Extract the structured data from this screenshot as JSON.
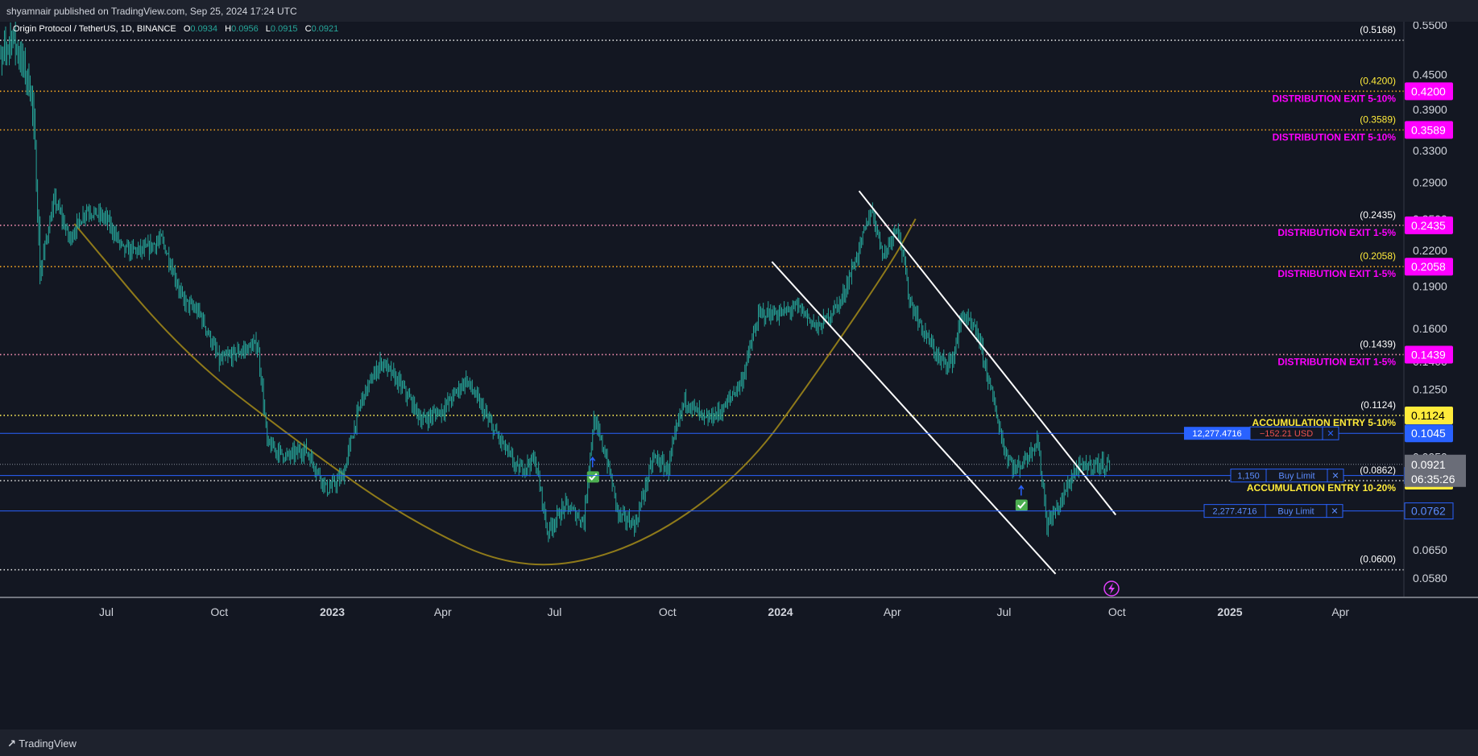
{
  "header": {
    "published": "shyamnair published on TradingView.com, Sep 25, 2024 17:24 UTC"
  },
  "footer": {
    "brand": "TradingView"
  },
  "legend": {
    "symbol": "Origin Protocol / TetherUS, 1D, BINANCE",
    "o_label": "O",
    "o_value": "0.0934",
    "h_label": "H",
    "h_value": "0.0956",
    "l_label": "L",
    "l_value": "0.0915",
    "c_label": "C",
    "c_value": "0.0921"
  },
  "colors": {
    "background": "#131722",
    "candle": "#26a69a",
    "orange_level": "#f5a623",
    "magenta_label": "#ff00ff",
    "yellow_label": "#ffeb3b",
    "blue_line": "#2962ff",
    "curve": "#8f7a1a"
  },
  "chart_data": {
    "type": "candlestick",
    "title": "Origin Protocol / TetherUS, 1D, BINANCE",
    "y_axis": {
      "ticks": [
        "0.5500",
        "0.4500",
        "0.3900",
        "0.3300",
        "0.2900",
        "0.2500",
        "0.2200",
        "0.1900",
        "0.1600",
        "0.1400",
        "0.1250",
        "0.0950",
        "0.0650",
        "0.0580"
      ],
      "tick_values": [
        0.55,
        0.45,
        0.39,
        0.33,
        0.29,
        0.25,
        0.22,
        0.19,
        0.16,
        0.14,
        0.125,
        0.095,
        0.065,
        0.058
      ]
    },
    "x_axis": {
      "ticks": [
        {
          "label": "Jul",
          "date": "2022-07-01",
          "bold": false
        },
        {
          "label": "Oct",
          "date": "2022-10-01",
          "bold": false
        },
        {
          "label": "2023",
          "date": "2023-01-01",
          "bold": true
        },
        {
          "label": "Apr",
          "date": "2023-04-01",
          "bold": false
        },
        {
          "label": "Jul",
          "date": "2023-07-01",
          "bold": false
        },
        {
          "label": "Oct",
          "date": "2023-10-01",
          "bold": false
        },
        {
          "label": "2024",
          "date": "2024-01-01",
          "bold": true
        },
        {
          "label": "Apr",
          "date": "2024-04-01",
          "bold": false
        },
        {
          "label": "Jul",
          "date": "2024-07-01",
          "bold": false
        },
        {
          "label": "Oct",
          "date": "2024-10-01",
          "bold": false
        },
        {
          "label": "2025",
          "date": "2025-01-01",
          "bold": true
        },
        {
          "label": "Apr",
          "date": "2025-04-01",
          "bold": false
        }
      ]
    },
    "price_path": [
      {
        "date": "2022-04-01",
        "price": 0.44
      },
      {
        "date": "2022-04-15",
        "price": 0.53
      },
      {
        "date": "2022-05-01",
        "price": 0.42
      },
      {
        "date": "2022-05-08",
        "price": 0.2
      },
      {
        "date": "2022-05-20",
        "price": 0.27
      },
      {
        "date": "2022-06-01",
        "price": 0.23
      },
      {
        "date": "2022-06-15",
        "price": 0.26
      },
      {
        "date": "2022-07-01",
        "price": 0.25
      },
      {
        "date": "2022-07-15",
        "price": 0.22
      },
      {
        "date": "2022-08-01",
        "price": 0.22
      },
      {
        "date": "2022-08-15",
        "price": 0.23
      },
      {
        "date": "2022-09-01",
        "price": 0.18
      },
      {
        "date": "2022-09-15",
        "price": 0.17
      },
      {
        "date": "2022-10-01",
        "price": 0.14
      },
      {
        "date": "2022-10-15",
        "price": 0.145
      },
      {
        "date": "2022-11-01",
        "price": 0.15
      },
      {
        "date": "2022-11-09",
        "price": 0.1
      },
      {
        "date": "2022-11-25",
        "price": 0.095
      },
      {
        "date": "2022-12-10",
        "price": 0.098
      },
      {
        "date": "2022-12-28",
        "price": 0.083
      },
      {
        "date": "2023-01-10",
        "price": 0.088
      },
      {
        "date": "2023-01-25",
        "price": 0.12
      },
      {
        "date": "2023-02-10",
        "price": 0.14
      },
      {
        "date": "2023-02-28",
        "price": 0.125
      },
      {
        "date": "2023-03-15",
        "price": 0.11
      },
      {
        "date": "2023-04-01",
        "price": 0.115
      },
      {
        "date": "2023-04-20",
        "price": 0.13
      },
      {
        "date": "2023-05-10",
        "price": 0.108
      },
      {
        "date": "2023-06-01",
        "price": 0.09
      },
      {
        "date": "2023-06-15",
        "price": 0.094
      },
      {
        "date": "2023-06-25",
        "price": 0.07
      },
      {
        "date": "2023-07-10",
        "price": 0.078
      },
      {
        "date": "2023-07-25",
        "price": 0.073
      },
      {
        "date": "2023-08-02",
        "price": 0.11
      },
      {
        "date": "2023-08-12",
        "price": 0.095
      },
      {
        "date": "2023-08-22",
        "price": 0.075
      },
      {
        "date": "2023-09-05",
        "price": 0.072
      },
      {
        "date": "2023-09-20",
        "price": 0.095
      },
      {
        "date": "2023-10-01",
        "price": 0.09
      },
      {
        "date": "2023-10-15",
        "price": 0.12
      },
      {
        "date": "2023-11-01",
        "price": 0.11
      },
      {
        "date": "2023-11-15",
        "price": 0.115
      },
      {
        "date": "2023-12-01",
        "price": 0.13
      },
      {
        "date": "2023-12-15",
        "price": 0.17
      },
      {
        "date": "2024-01-01",
        "price": 0.17
      },
      {
        "date": "2024-01-15",
        "price": 0.175
      },
      {
        "date": "2024-02-01",
        "price": 0.16
      },
      {
        "date": "2024-02-20",
        "price": 0.18
      },
      {
        "date": "2024-03-05",
        "price": 0.22
      },
      {
        "date": "2024-03-15",
        "price": 0.26
      },
      {
        "date": "2024-03-25",
        "price": 0.215
      },
      {
        "date": "2024-04-05",
        "price": 0.245
      },
      {
        "date": "2024-04-15",
        "price": 0.18
      },
      {
        "date": "2024-04-25",
        "price": 0.16
      },
      {
        "date": "2024-05-10",
        "price": 0.14
      },
      {
        "date": "2024-05-20",
        "price": 0.14
      },
      {
        "date": "2024-05-28",
        "price": 0.17
      },
      {
        "date": "2024-06-10",
        "price": 0.155
      },
      {
        "date": "2024-06-20",
        "price": 0.125
      },
      {
        "date": "2024-07-01",
        "price": 0.098
      },
      {
        "date": "2024-07-10",
        "price": 0.09
      },
      {
        "date": "2024-07-20",
        "price": 0.095
      },
      {
        "date": "2024-07-28",
        "price": 0.102
      },
      {
        "date": "2024-08-05",
        "price": 0.072
      },
      {
        "date": "2024-08-15",
        "price": 0.078
      },
      {
        "date": "2024-08-28",
        "price": 0.09
      },
      {
        "date": "2024-09-10",
        "price": 0.092
      },
      {
        "date": "2024-09-25",
        "price": 0.0921
      }
    ],
    "horizontal_levels": [
      {
        "price": 0.5168,
        "style": "white-dotted",
        "right_label": "(0.5168)",
        "right_label_color": "white"
      },
      {
        "price": 0.42,
        "style": "orange-dotted",
        "right_label": "(0.4200)",
        "right_label_color": "yellow",
        "axis_tag": "0.4200",
        "axis_tag_color": "magenta",
        "note": "DISTRIBUTION EXIT 5-10%",
        "note_color": "magenta"
      },
      {
        "price": 0.3589,
        "style": "orange-dotted",
        "right_label": "(0.3589)",
        "right_label_color": "yellow",
        "axis_tag": "0.3589",
        "axis_tag_color": "magenta",
        "note": "DISTRIBUTION EXIT 5-10%",
        "note_color": "magenta"
      },
      {
        "price": 0.2435,
        "style": "pink-dotted",
        "right_label": "(0.2435)",
        "right_label_color": "white",
        "axis_tag": "0.2435",
        "axis_tag_color": "magenta",
        "note": "DISTRIBUTION EXIT 1-5%",
        "note_color": "magenta"
      },
      {
        "price": 0.2058,
        "style": "orange-dotted",
        "right_label": "(0.2058)",
        "right_label_color": "yellow",
        "axis_tag": "0.2058",
        "axis_tag_color": "magenta",
        "note": "DISTRIBUTION EXIT 1-5%",
        "note_color": "magenta"
      },
      {
        "price": 0.1439,
        "style": "pink-dotted",
        "right_label": "(0.1439)",
        "right_label_color": "white",
        "axis_tag": "0.1439",
        "axis_tag_color": "magenta",
        "note": "DISTRIBUTION EXIT 1-5%",
        "note_color": "magenta"
      },
      {
        "price": 0.1124,
        "style": "yellow-dotted",
        "right_label": "(0.1124)",
        "right_label_color": "white",
        "axis_tag": "0.1124",
        "axis_tag_color": "yellow",
        "note": "ACCUMULATION ENTRY 5-10%",
        "note_color": "yellow"
      },
      {
        "price": 0.0862,
        "style": "white-dotted",
        "right_label": "(0.0862)",
        "right_label_color": "white",
        "axis_tag": "0.0862",
        "axis_tag_color": "yellow",
        "note": "ACCUMULATION ENTRY 10-20%",
        "note_color": "yellow"
      },
      {
        "price": 0.06,
        "style": "white-dotted",
        "right_label": "(0.0600)",
        "right_label_color": "white"
      }
    ],
    "position_line": {
      "price": 0.1045,
      "quantity": "12,277.4716",
      "pnl": "−152.21 USD",
      "axis_tag": "0.1045",
      "close_symbol": "✕"
    },
    "orders": [
      {
        "price": 0.088,
        "quantity": "1,150",
        "type": "Buy Limit",
        "axis_tag": "0.0880",
        "close_symbol": "✕"
      },
      {
        "price": 0.0762,
        "quantity": "2,277.4716",
        "type": "Buy Limit",
        "axis_tag": "0.0762",
        "close_symbol": "✕"
      }
    ],
    "current_price": {
      "price": 0.0921,
      "label": "0.0921",
      "countdown": "06:35:26"
    },
    "trendlines": [
      {
        "start": {
          "date": "2023-12-25",
          "price": 0.21
        },
        "end": {
          "date": "2024-08-12",
          "price": 0.059
        },
        "color": "white"
      },
      {
        "start": {
          "date": "2024-03-05",
          "price": 0.28
        },
        "end": {
          "date": "2024-09-30",
          "price": 0.075
        },
        "color": "white"
      }
    ],
    "rounding_bottom_curve": {
      "points": [
        {
          "date": "2022-06-05",
          "price": 0.245
        },
        {
          "date": "2022-09-01",
          "price": 0.145
        },
        {
          "date": "2022-12-01",
          "price": 0.102
        },
        {
          "date": "2023-03-01",
          "price": 0.074
        },
        {
          "date": "2023-06-01",
          "price": 0.0595
        },
        {
          "date": "2023-09-01",
          "price": 0.0645
        },
        {
          "date": "2023-12-01",
          "price": 0.088
        },
        {
          "date": "2024-02-01",
          "price": 0.135
        },
        {
          "date": "2024-04-01",
          "price": 0.21
        },
        {
          "date": "2024-04-20",
          "price": 0.25
        }
      ]
    },
    "markers": [
      {
        "date": "2023-08-01",
        "price": 0.0875,
        "kind": "buy-check"
      },
      {
        "date": "2024-07-15",
        "price": 0.078,
        "kind": "buy-check"
      }
    ],
    "grid": false
  }
}
